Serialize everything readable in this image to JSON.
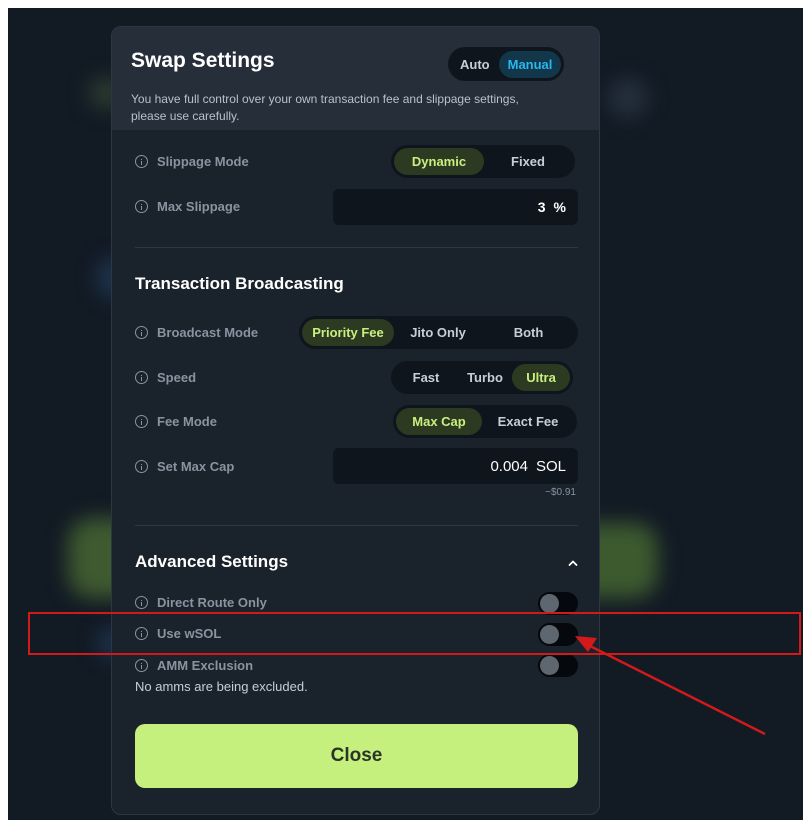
{
  "header": {
    "title": "Swap Settings",
    "subtitle": "You have full control over your own transaction fee and slippage settings, please use carefully.",
    "mode_options": [
      "Auto",
      "Manual"
    ],
    "mode_selected": "Manual"
  },
  "slippage": {
    "mode_label": "Slippage Mode",
    "mode_options": [
      "Dynamic",
      "Fixed"
    ],
    "mode_selected": "Dynamic",
    "max_label": "Max Slippage",
    "max_value": "3",
    "max_unit": "%"
  },
  "broadcasting": {
    "title": "Transaction Broadcasting",
    "broadcast_label": "Broadcast Mode",
    "broadcast_options": [
      "Priority Fee",
      "Jito Only",
      "Both"
    ],
    "broadcast_selected": "Priority Fee",
    "speed_label": "Speed",
    "speed_options": [
      "Fast",
      "Turbo",
      "Ultra"
    ],
    "speed_selected": "Ultra",
    "fee_mode_label": "Fee Mode",
    "fee_mode_options": [
      "Max Cap",
      "Exact Fee"
    ],
    "fee_mode_selected": "Max Cap",
    "max_cap_label": "Set Max Cap",
    "max_cap_value": "0.004",
    "max_cap_unit": "SOL",
    "max_cap_usd": "~$0.91"
  },
  "advanced": {
    "title": "Advanced Settings",
    "direct_route_label": "Direct Route Only",
    "direct_route_on": false,
    "wsol_label": "Use wSOL",
    "wsol_on": false,
    "amm_label": "AMM Exclusion",
    "amm_on": false,
    "amm_note": "No amms are being excluded."
  },
  "close_label": "Close",
  "colors": {
    "accent_green": "#c6f07e",
    "accent_blue": "#2ab6ee",
    "annotation_red": "#d21a1a"
  }
}
